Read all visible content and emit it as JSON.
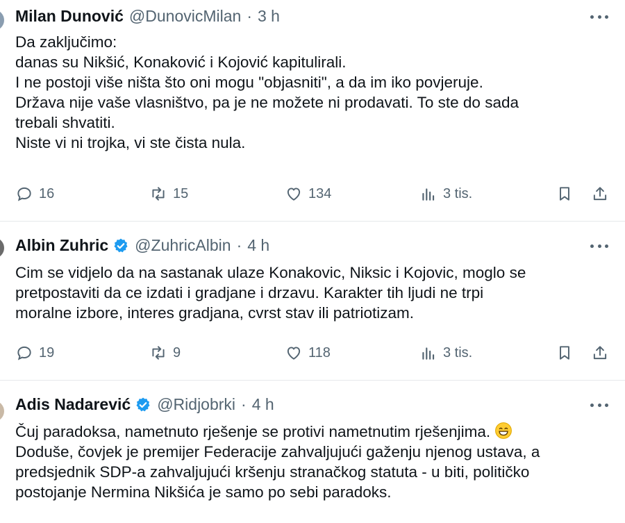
{
  "tweets": [
    {
      "name": "Milan Dunović",
      "handle": "@DunovicMilan",
      "sep": "·",
      "time": "3 h",
      "verified": false,
      "lines": [
        "Da zaključimo:",
        "danas su Nikšić, Konaković i Kojović kapitulirali.",
        "I ne postoji više ništa što oni mogu \"objasniti\", a da im iko povjeruje.",
        "Država nije vaše vlasništvo, pa je ne možete ni prodavati. To ste do sada",
        "trebali shvatiti.",
        "Niste vi ni trojka, vi ste čista nula."
      ],
      "replies": "16",
      "reposts": "15",
      "likes": "134",
      "views": "3 tis."
    },
    {
      "name": "Albin Zuhric",
      "handle": "@ZuhricAlbin",
      "sep": "·",
      "time": "4 h",
      "verified": true,
      "lines": [
        "Cim se vidjelo da na sastanak ulaze Konakovic, Niksic i Kojovic, moglo se",
        "pretpostaviti da ce izdati i gradjane i drzavu. Karakter tih ljudi ne trpi",
        "moralne izbore, interes gradjana, cvrst stav ili patriotizam."
      ],
      "replies": "19",
      "reposts": "9",
      "likes": "118",
      "views": "3 tis."
    },
    {
      "name": "Adis Nadarević",
      "handle": "@Ridjobrki",
      "sep": "·",
      "time": "4 h",
      "verified": true,
      "lines": [
        "Čuj paradoksa, nametnuto rješenje se protivi nametnutim rješenjima.",
        "Doduše, čovjek je premijer Federacije zahvaljujući gaženju njenog ustava, a",
        "predsjednik SDP-a zahvaljujući kršenju stranačkog statuta - u biti, političko",
        "postojanje Nermina Nikšića je samo po sebi paradoks."
      ],
      "emoji": "grinning-face-emoji"
    }
  ],
  "icons": {
    "reply": "reply-icon",
    "repost": "repost-icon",
    "like": "like-icon",
    "views": "views-icon",
    "bookmark": "bookmark-icon",
    "share": "share-icon",
    "more": "more-icon",
    "verified": "verified-badge-icon"
  },
  "colors": {
    "text": "#0f1419",
    "secondary": "#536471",
    "verified": "#1d9bf0",
    "divider": "#e6e9eb"
  }
}
